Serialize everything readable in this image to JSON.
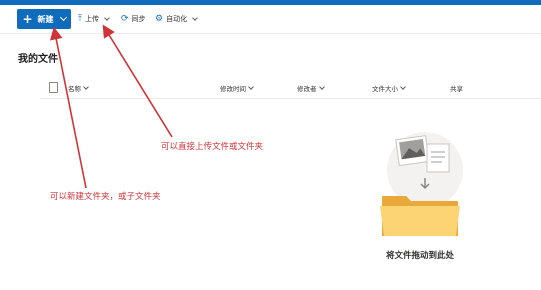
{
  "toolbar": {
    "new_label": "新建",
    "upload_label": "上传",
    "sync_label": "同步",
    "automate_label": "自动化"
  },
  "page": {
    "title": "我的文件"
  },
  "columns": {
    "name": "名称",
    "modified": "修改时间",
    "modified_by": "修改者",
    "file_size": "文件大小",
    "sharing": "共享"
  },
  "annotations": {
    "upload_hint": "可以直接上传文件或文件夹",
    "new_hint": "可以新建文件夹，或子文件夹"
  },
  "empty_state": {
    "message": "将文件拖动到此处"
  },
  "colors": {
    "accent": "#0f6cbd",
    "annotation": "#d13438"
  }
}
